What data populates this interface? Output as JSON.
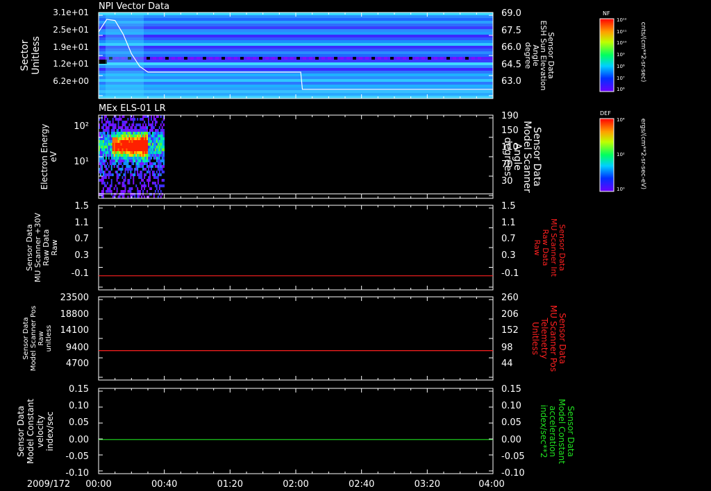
{
  "date_label": "2009/172",
  "time_ticks": [
    "00:00",
    "00:40",
    "01:20",
    "02:00",
    "02:40",
    "03:20",
    "04:00"
  ],
  "panels": [
    {
      "title": "NPI Vector Data",
      "left_label": [
        "Sector",
        "Unitless"
      ],
      "left_ticks": [
        "3.1e+01",
        "2.5e+01",
        "1.9e+01",
        "1.2e+01",
        "6.2e+00"
      ],
      "right_ticks": [
        "69.0",
        "67.5",
        "66.0",
        "64.5",
        "63.0"
      ],
      "right_label": [
        "Sensor Data",
        "ESH Sun Elevation",
        "Angle",
        "degree"
      ],
      "right_label_color": "#ffffff",
      "colorbar": {
        "name": "NF",
        "unit": "cnts/(cm**2-sr-sec)",
        "ticks": [
          "10¹²",
          "10¹¹",
          "10¹⁰",
          "10⁹",
          "10⁸",
          "10⁷",
          "10⁶"
        ]
      }
    },
    {
      "title": "MEx ELS-01 LR",
      "left_label": [
        "Electron Energy",
        "eV"
      ],
      "left_ticks": [
        "10²",
        "10¹"
      ],
      "right_ticks": [
        "190",
        "150",
        "110",
        "70",
        "30"
      ],
      "right_label": [
        "Sensor Data",
        "Model Scanner",
        "Angle",
        "degrees"
      ],
      "right_label_color": "#ffffff",
      "colorbar": {
        "name": "DEF",
        "unit": "ergs/(cm**2-sr-sec-eV)",
        "ticks": [
          "10⁴",
          "10²",
          "10⁰"
        ]
      }
    },
    {
      "left_label": [
        "Sensor Data",
        "MU Scanner +30V",
        "Raw Data",
        "Raw"
      ],
      "left_ticks": [
        "1.5",
        "1.1",
        "0.7",
        "0.3",
        "-0.1"
      ],
      "right_ticks": [
        "1.5",
        "1.1",
        "0.7",
        "0.3",
        "-0.1"
      ],
      "right_label": [
        "Sensor Data",
        "MU Scanner Int",
        "Raw Data",
        "Raw"
      ],
      "right_label_color": "#ff2020"
    },
    {
      "left_label": [
        "Sensor Data",
        "Model Scanner Pos",
        "Raw",
        "unitless"
      ],
      "left_ticks": [
        "23500",
        "18800",
        "14100",
        "9400",
        "4700"
      ],
      "right_ticks": [
        "260",
        "206",
        "152",
        "98",
        "44"
      ],
      "right_label": [
        "Sensor Data",
        "MU Scanner Pos",
        "Telemetry",
        "Unitless"
      ],
      "right_label_color": "#ff2020"
    },
    {
      "left_label": [
        "Sensor Data",
        "Model Constant",
        "velocity",
        "index/sec"
      ],
      "left_ticks": [
        "0.15",
        "0.10",
        "0.05",
        "0.00",
        "-0.05",
        "-0.10"
      ],
      "right_ticks": [
        "0.15",
        "0.10",
        "0.05",
        "0.00",
        "-0.05",
        "-0.10"
      ],
      "right_label": [
        "Sensor Data",
        "Model Constant",
        "acceleration",
        "index/sec**2"
      ],
      "right_label_color": "#20e020"
    }
  ],
  "chart_data": [
    {
      "type": "heatmap",
      "title": "NPI Vector Data",
      "ylabel": "Sector Unitless",
      "y2label": "Sensor Data ESH Sun Elevation Angle degree",
      "x_range": [
        "2009/172 00:00",
        "2009/172 04:00"
      ],
      "overlay_line": {
        "name": "ESH Sun Elevation Angle",
        "x_min": [
          0,
          5,
          10,
          15,
          20,
          25,
          30,
          40,
          60,
          80,
          100,
          120,
          123,
          124,
          140,
          180,
          220,
          240
        ],
        "y_deg": [
          67.8,
          68.9,
          68.8,
          67.6,
          65.9,
          64.8,
          64.3,
          64.3,
          64.3,
          64.3,
          64.3,
          64.3,
          64.3,
          62.8,
          62.8,
          62.8,
          62.8,
          62.8
        ],
        "ylim": [
          62.0,
          69.5
        ]
      }
    },
    {
      "type": "heatmap",
      "title": "MEx ELS-01 LR",
      "ylabel": "Electron Energy eV",
      "y2label": "Sensor Data Model Scanner Angle degrees",
      "data_coverage_minutes": [
        0,
        40
      ],
      "overlay_line": {
        "name": "Model Scanner Angle",
        "y_deg": [
          10,
          10
        ],
        "ylim": [
          0,
          190
        ]
      }
    },
    {
      "type": "line",
      "ylabel": "Sensor Data MU Scanner +30V Raw Data Raw",
      "y2label": "Sensor Data MU Scanner Int Raw Data Raw",
      "x_min": [
        0,
        240
      ],
      "y": [
        0.0,
        0.0
      ],
      "ylim": [
        -0.3,
        1.5
      ],
      "line_color": "#ff2020"
    },
    {
      "type": "line",
      "ylabel": "Sensor Data Model Scanner Pos Raw unitless",
      "y2label": "Sensor Data MU Scanner Pos Telemetry Unitless",
      "x_min": [
        0,
        240
      ],
      "y": [
        8300,
        8300
      ],
      "ylim": [
        0,
        23500
      ],
      "line_color": "#ff2020"
    },
    {
      "type": "line",
      "ylabel": "Sensor Data Model Constant velocity index/sec",
      "y2label": "Sensor Data Model Constant acceleration index/sec**2",
      "x_min": [
        0,
        240
      ],
      "y": [
        0.0,
        0.0
      ],
      "ylim": [
        -0.1,
        0.15
      ],
      "line_color": "#20e020"
    }
  ]
}
